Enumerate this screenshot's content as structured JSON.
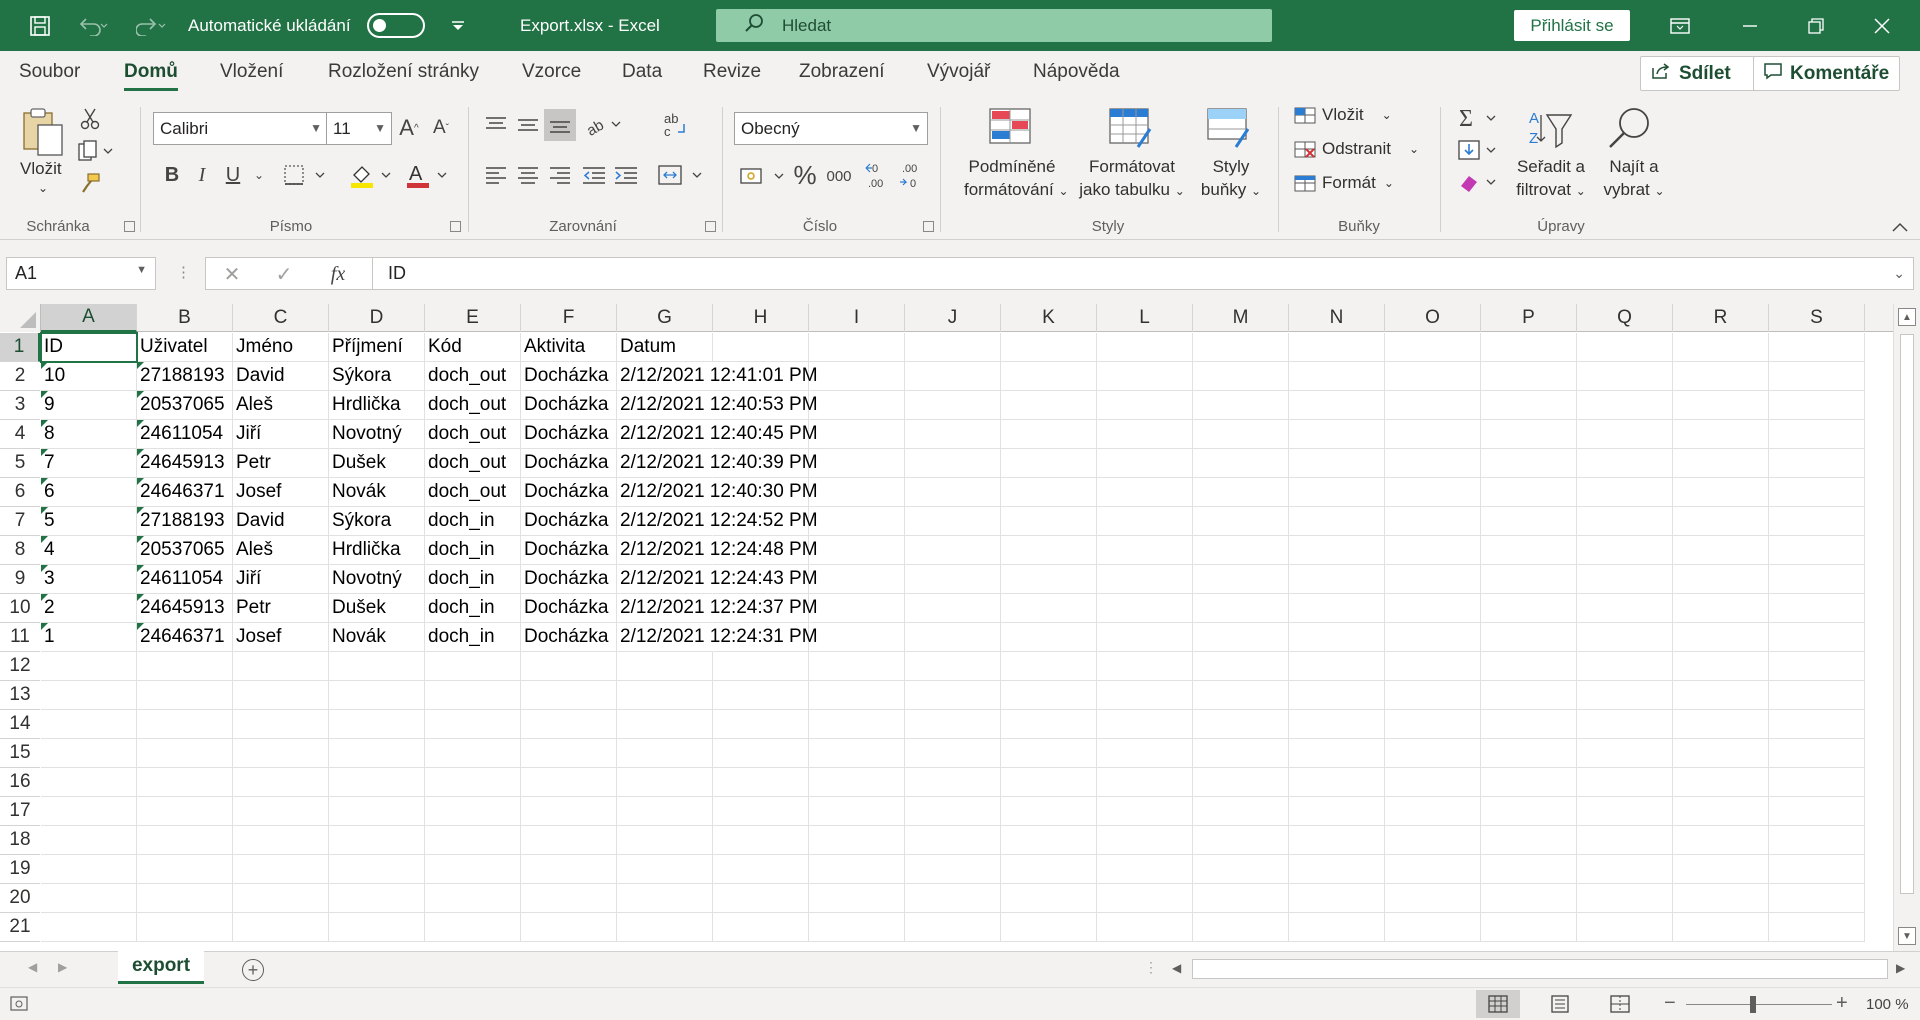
{
  "titlebar": {
    "autosave_label": "Automatické ukládání",
    "file_title": "Export.xlsx  -  Excel",
    "search_placeholder": "Hledat",
    "signin_label": "Přihlásit se"
  },
  "menu": {
    "tabs": [
      "Soubor",
      "Domů",
      "Vložení",
      "Rozložení stránky",
      "Vzorce",
      "Data",
      "Revize",
      "Zobrazení",
      "Vývojář",
      "Nápověda"
    ],
    "active_tab": "Domů",
    "share_label": "Sdílet",
    "comments_label": "Komentáře"
  },
  "ribbon": {
    "clipboard": {
      "paste_label": "Vložit",
      "group_label": "Schránka"
    },
    "font": {
      "font_name": "Calibri",
      "font_size": "11",
      "group_label": "Písmo",
      "bold": "B",
      "italic": "I",
      "underline": "U"
    },
    "alignment": {
      "group_label": "Zarovnání"
    },
    "number": {
      "format": "Obecný",
      "group_label": "Číslo",
      "percent": "%",
      "thousands": "000"
    },
    "styles": {
      "conditional_line1": "Podmíněné",
      "conditional_line2": "formátování",
      "format_table_line1": "Formátovat",
      "format_table_line2": "jako tabulku",
      "cell_styles_line1": "Styly",
      "cell_styles_line2": "buňky",
      "group_label": "Styly"
    },
    "cells": {
      "insert": "Vložit",
      "delete": "Odstranit",
      "format": "Formát",
      "group_label": "Buňky"
    },
    "editing": {
      "sort_line1": "Seřadit a",
      "sort_line2": "filtrovat",
      "find_line1": "Najít a",
      "find_line2": "vybrat",
      "group_label": "Úpravy"
    }
  },
  "formula_bar": {
    "name_box": "A1",
    "formula": "ID"
  },
  "columns": [
    "A",
    "B",
    "C",
    "D",
    "E",
    "F",
    "G",
    "H",
    "I",
    "J",
    "K",
    "L",
    "M",
    "N",
    "O",
    "P",
    "Q",
    "R",
    "S"
  ],
  "rows": [
    "1",
    "2",
    "3",
    "4",
    "5",
    "6",
    "7",
    "8",
    "9",
    "10",
    "11",
    "12",
    "13",
    "14",
    "15",
    "16",
    "17",
    "18",
    "19",
    "20",
    "21"
  ],
  "sheet": {
    "header": [
      "ID",
      "Uživatel",
      "Jméno",
      "Příjmení",
      "Kód",
      "Aktivita",
      "Datum"
    ],
    "data": [
      [
        "10",
        "27188193",
        "David",
        "Sýkora",
        "doch_out",
        "Docházka",
        "2/12/2021 12:41:01 PM"
      ],
      [
        "9",
        "20537065",
        "Aleš",
        "Hrdlička",
        "doch_out",
        "Docházka",
        "2/12/2021 12:40:53 PM"
      ],
      [
        "8",
        "24611054",
        "Jiří",
        "Novotný",
        "doch_out",
        "Docházka",
        "2/12/2021 12:40:45 PM"
      ],
      [
        "7",
        "24645913",
        "Petr",
        "Dušek",
        "doch_out",
        "Docházka",
        "2/12/2021 12:40:39 PM"
      ],
      [
        "6",
        "24646371",
        "Josef",
        "Novák",
        "doch_out",
        "Docházka",
        "2/12/2021 12:40:30 PM"
      ],
      [
        "5",
        "27188193",
        "David",
        "Sýkora",
        "doch_in",
        "Docházka",
        "2/12/2021 12:24:52 PM"
      ],
      [
        "4",
        "20537065",
        "Aleš",
        "Hrdlička",
        "doch_in",
        "Docházka",
        "2/12/2021 12:24:48 PM"
      ],
      [
        "3",
        "24611054",
        "Jiří",
        "Novotný",
        "doch_in",
        "Docházka",
        "2/12/2021 12:24:43 PM"
      ],
      [
        "2",
        "24645913",
        "Petr",
        "Dušek",
        "doch_in",
        "Docházka",
        "2/12/2021 12:24:37 PM"
      ],
      [
        "1",
        "24646371",
        "Josef",
        "Novák",
        "doch_in",
        "Docházka",
        "2/12/2021 12:24:31 PM"
      ]
    ]
  },
  "sheet_tabs": {
    "active": "export"
  },
  "statusbar": {
    "zoom": "100 %"
  },
  "colors": {
    "accent": "#217346",
    "text": "#252423"
  }
}
